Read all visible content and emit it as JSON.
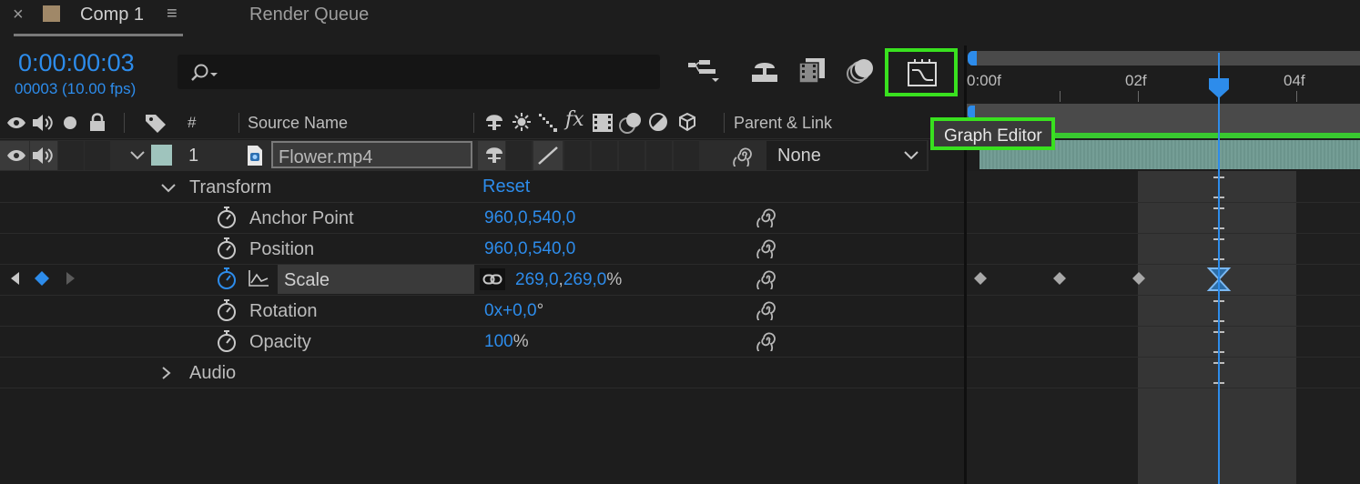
{
  "tabs": {
    "close": "×",
    "comp": "Comp 1",
    "menu": "≡",
    "render_queue": "Render Queue"
  },
  "timecode": {
    "current": "0:00:00:03",
    "frames": "00003 (10.00 fps)"
  },
  "search": {
    "placeholder": ""
  },
  "toolbar": {
    "graph_editor_tooltip": "Graph Editor"
  },
  "columns": {
    "number": "#",
    "source_name": "Source Name",
    "parent_link": "Parent & Link"
  },
  "layer": {
    "number": "1",
    "name": "Flower.mp4",
    "label_color": "#9fc4bd",
    "parent": "None"
  },
  "transform": {
    "label": "Transform",
    "reset": "Reset",
    "properties": [
      {
        "name": "Anchor Point",
        "value": "960,0,540,0"
      },
      {
        "name": "Position",
        "value": "960,0,540,0"
      },
      {
        "name": "Scale",
        "value_x": "269,0",
        "sep": ",",
        "value_y": "269,0",
        "unit": "%"
      },
      {
        "name": "Rotation",
        "value": "0x+0,0",
        "unit": "°"
      },
      {
        "name": "Opacity",
        "value": "100",
        "unit": "%"
      }
    ]
  },
  "audio": {
    "label": "Audio"
  },
  "timeline": {
    "ruler_labels": [
      "0:00f",
      "02f",
      "04f"
    ],
    "current_frame": 3,
    "scale_keyframes": [
      0,
      1,
      2,
      3
    ]
  },
  "colors": {
    "accent_blue": "#2d8ceb",
    "highlight_green": "#39e11f",
    "layer_bar": "#6f9a92"
  }
}
